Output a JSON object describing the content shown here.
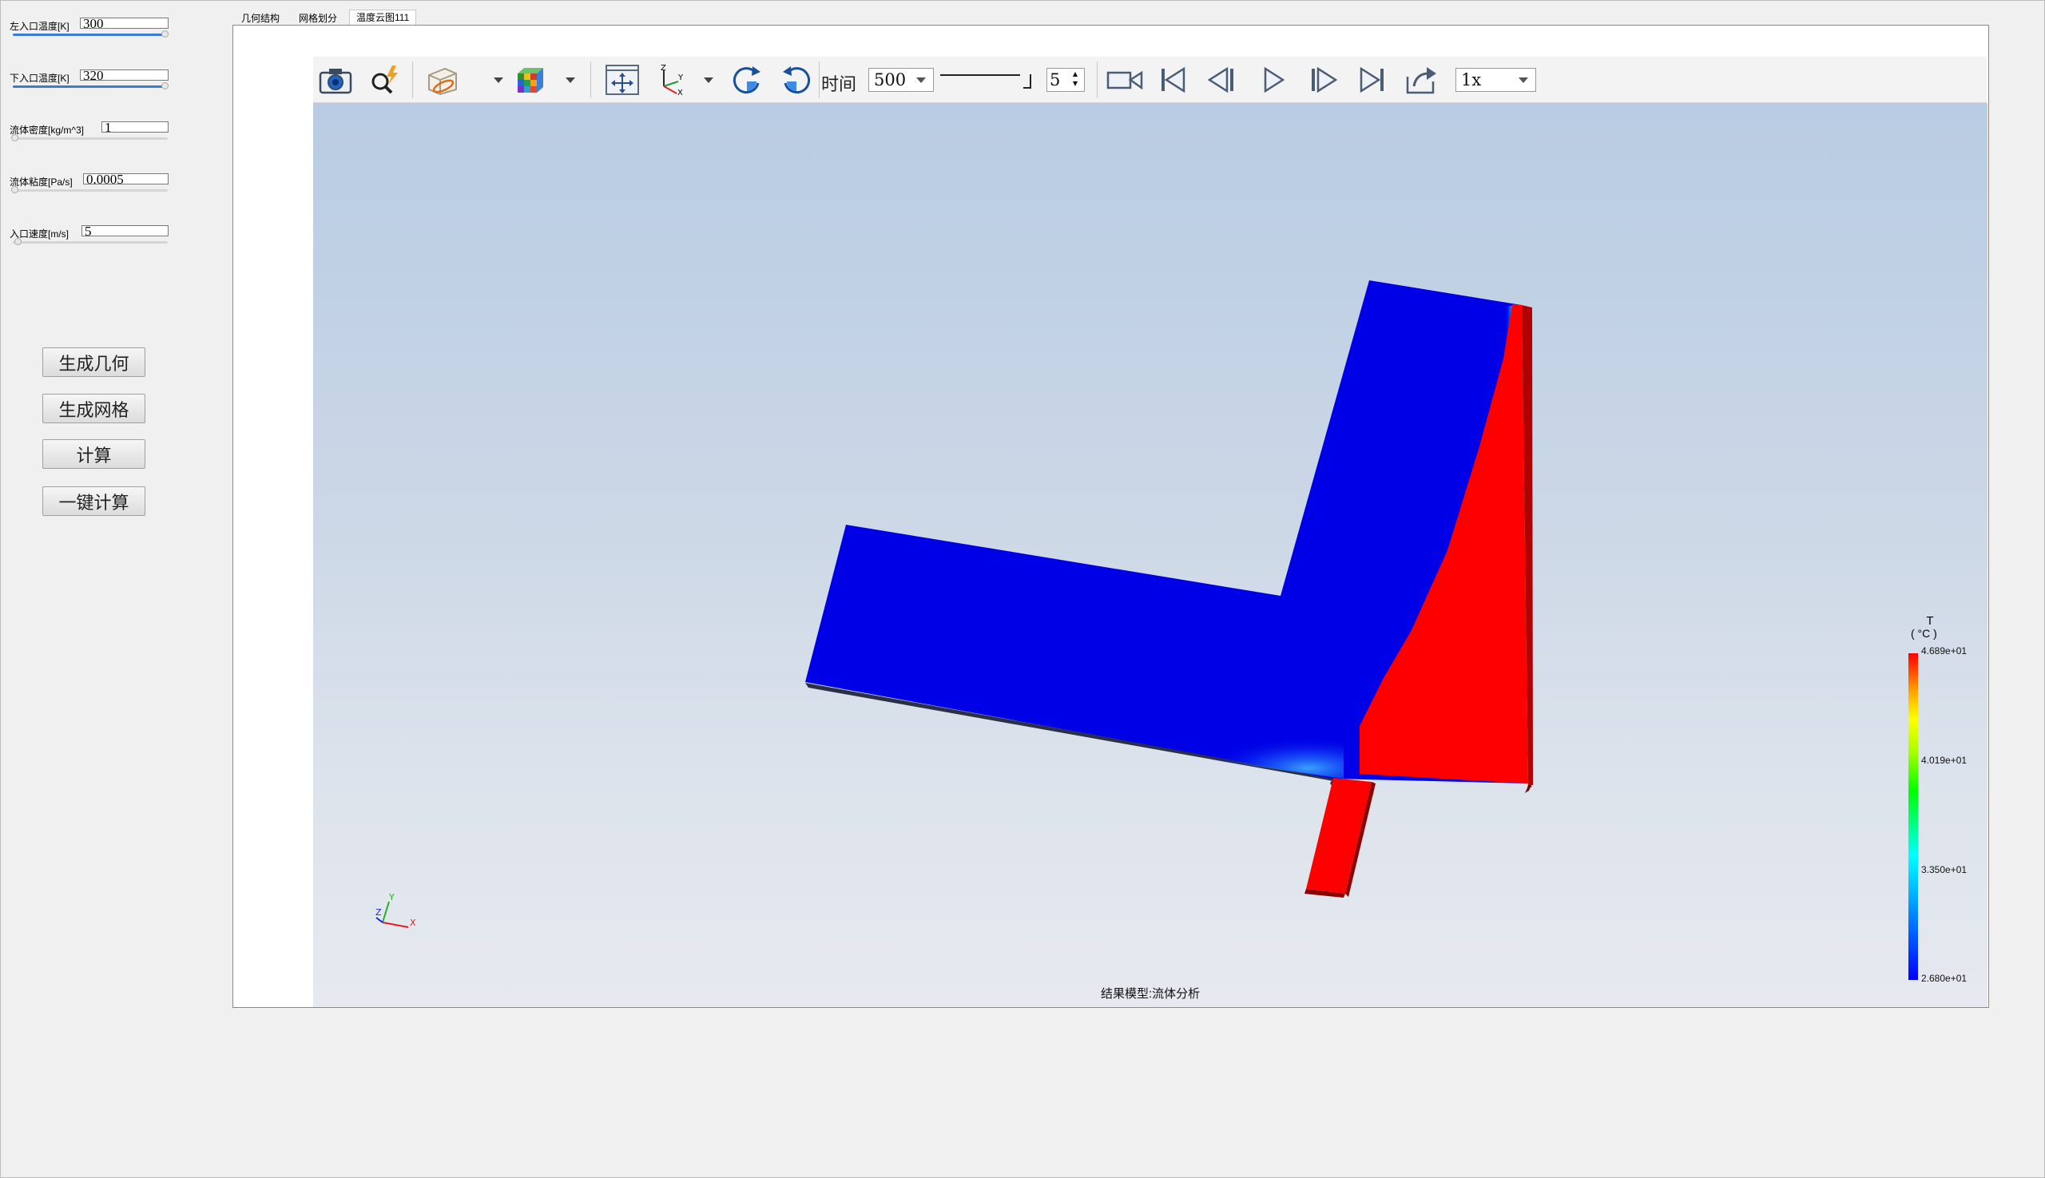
{
  "params": [
    {
      "label": "左入口温度[K]",
      "value": "300"
    },
    {
      "label": "下入口温度[K]",
      "value": "320"
    },
    {
      "label": "流体密度[kg/m^3]",
      "value": "1"
    },
    {
      "label": "流体粘度[Pa/s]",
      "value": "0.0005"
    },
    {
      "label": "入口速度[m/s]",
      "value": "5"
    }
  ],
  "actions": {
    "generate_geometry": "生成几何",
    "generate_mesh": "生成网格",
    "compute": "计算",
    "one_click_compute": "一键计算"
  },
  "tabs": [
    "几何结构",
    "网格划分",
    "温度云图111"
  ],
  "active_tab": 2,
  "toolbar": {
    "time_label": "时间",
    "time_value": "500",
    "frame_value": "5",
    "speed_value": "1x",
    "icons": [
      "camera-icon",
      "zoom-icon",
      "clip-plane-icon",
      "colormap-cube-icon",
      "fit-view-icon",
      "axes-orientation-icon",
      "rotate-cw-icon",
      "rotate-ccw-icon",
      "record-video-icon",
      "first-frame-icon",
      "prev-frame-icon",
      "play-icon",
      "next-frame-icon",
      "last-frame-icon",
      "export-icon"
    ]
  },
  "viewport": {
    "caption": "结果模型:流体分析",
    "axes_labels": {
      "x": "X",
      "y": "Y",
      "z": "Z"
    }
  },
  "legend": {
    "title": "T",
    "unit": "( °C )",
    "ticks": [
      "4.689e+01",
      "4.019e+01",
      "3.350e+01",
      "2.680e+01"
    ],
    "colors": {
      "max": "#ff0000",
      "min": "#0000ff",
      "background_top": "#b8cce3",
      "background_bottom": "#e6e9ef"
    }
  }
}
